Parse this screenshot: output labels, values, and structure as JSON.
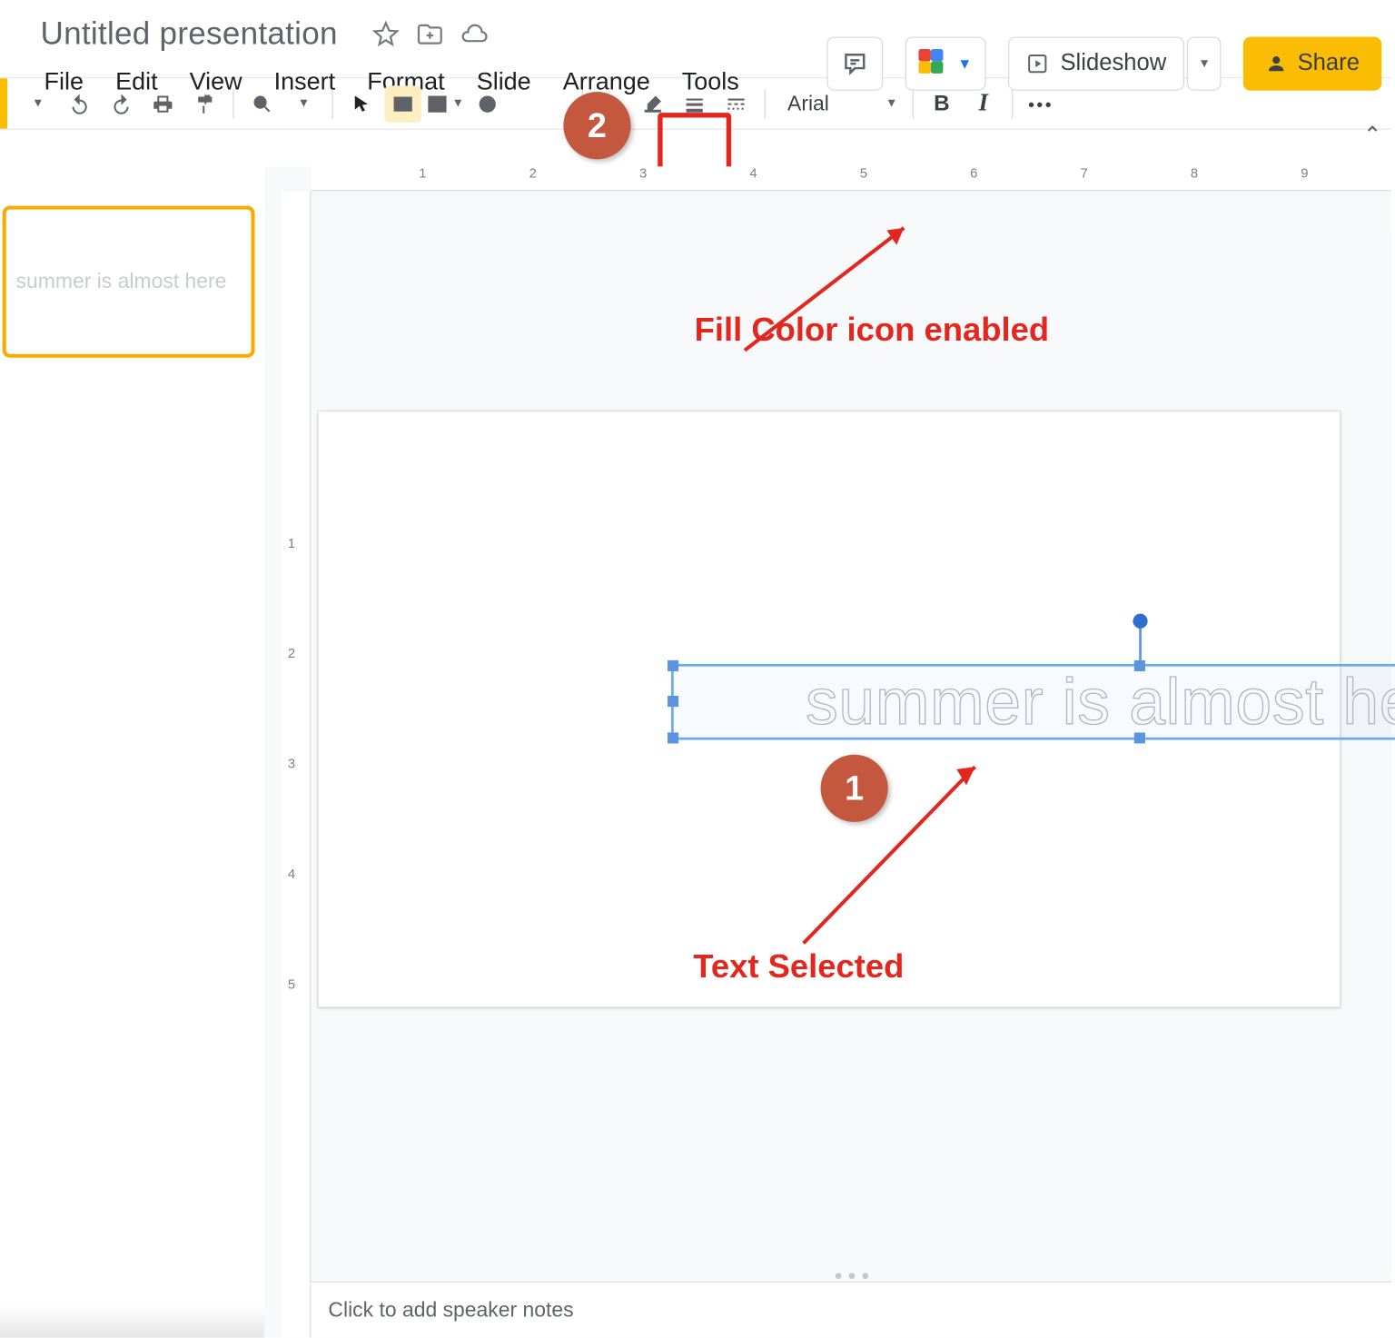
{
  "doc": {
    "title": "Untitled presentation"
  },
  "menus": {
    "file": "File",
    "edit": "Edit",
    "view": "View",
    "insert": "Insert",
    "format": "Format",
    "slide": "Slide",
    "arrange": "Arrange",
    "tools": "Tools"
  },
  "header": {
    "slideshow": "Slideshow",
    "share": "Share"
  },
  "toolbar": {
    "font": "Arial"
  },
  "slide": {
    "text": "summer is almost here"
  },
  "thumb": {
    "text": "summer is almost here"
  },
  "speaker": {
    "placeholder": "Click to add speaker notes"
  },
  "annotations": {
    "fill_label": "Fill Color icon enabled",
    "sel_label": "Text Selected",
    "badge1": "1",
    "badge2": "2"
  },
  "ruler": {
    "h": [
      "1",
      "2",
      "3",
      "4",
      "5",
      "6",
      "7",
      "8",
      "9"
    ],
    "v": [
      "1",
      "2",
      "3",
      "4",
      "5"
    ]
  }
}
